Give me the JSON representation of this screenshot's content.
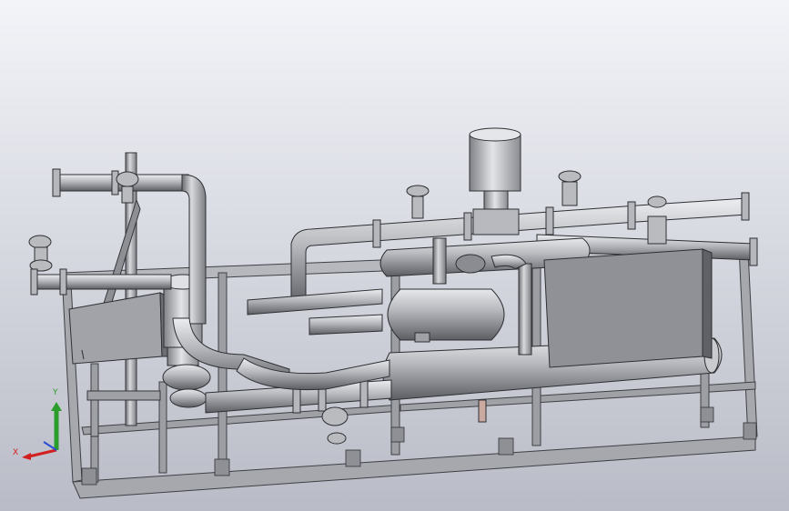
{
  "viewport": {
    "background_top": "#f3f4f8",
    "background_bottom": "#b9bbc6"
  },
  "model": {
    "description_icon": "industrial-pump-skid-3d-model",
    "metal_color": "#a9abb0",
    "metal_dark": "#6f7176",
    "metal_light": "#d4d6da",
    "panel_color": "#8b8d92"
  },
  "triad": {
    "x_label": "X",
    "y_label": "Y",
    "x_color": "#d21f1f",
    "y_color": "#2a9d2a",
    "z_color": "#2a4fd2"
  }
}
